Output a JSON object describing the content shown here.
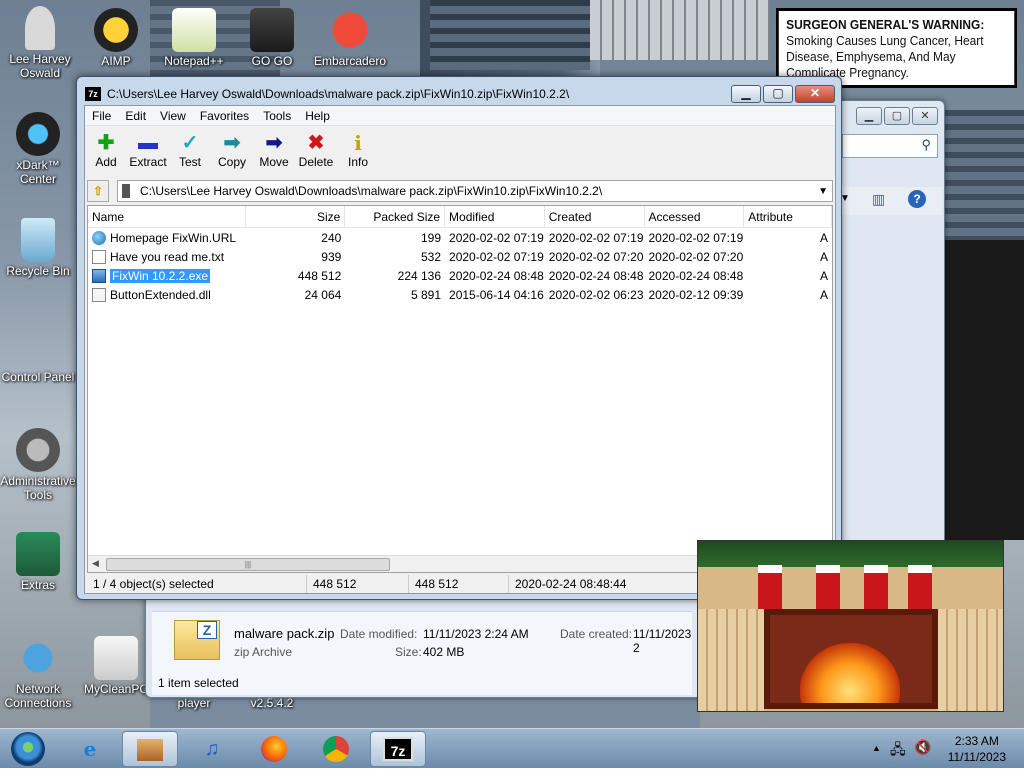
{
  "desktop": {
    "icons": [
      {
        "label": "Lee Harvey Oswald"
      },
      {
        "label": "AIMP"
      },
      {
        "label": "Notepad++"
      },
      {
        "label": "GO GO"
      },
      {
        "label": "Embarcadero"
      },
      {
        "label": "xDark™ Center"
      },
      {
        "label": "Recycle Bin"
      },
      {
        "label": "Control Panel"
      },
      {
        "label": "Administrative Tools"
      },
      {
        "label": "Extras"
      },
      {
        "label": "Network Connections"
      },
      {
        "label": "MyCleanPC"
      },
      {
        "label": "player"
      },
      {
        "label": "v2.5.4.2"
      }
    ],
    "warning": {
      "lead": "SURGEON GENERAL'S WARNING:",
      "text": "Smoking Causes Lung Cancer, Heart Disease, Emphysema, And May Complicate Pregnancy."
    }
  },
  "explorer": {
    "file_name": "malware pack.zip",
    "date_modified_label": "Date modified:",
    "date_modified": "11/11/2023 2:24 AM",
    "date_created_label": "Date created:",
    "date_created": "11/11/2023 2",
    "type": "zip Archive",
    "size_label": "Size:",
    "size": "402 MB",
    "status": "1 item selected"
  },
  "sevenzip": {
    "title": "C:\\Users\\Lee Harvey Oswald\\Downloads\\malware pack.zip\\FixWin10.zip\\FixWin10.2.2\\",
    "menu": [
      "File",
      "Edit",
      "View",
      "Favorites",
      "Tools",
      "Help"
    ],
    "toolbar": [
      {
        "label": "Add",
        "glyph": "✚",
        "color": "#19a019"
      },
      {
        "label": "Extract",
        "glyph": "▬",
        "color": "#2434c8"
      },
      {
        "label": "Test",
        "glyph": "✓",
        "color": "#20a8c8"
      },
      {
        "label": "Copy",
        "glyph": "➡",
        "color": "#1c8a9a"
      },
      {
        "label": "Move",
        "glyph": "➡",
        "color": "#101a90"
      },
      {
        "label": "Delete",
        "glyph": "✖",
        "color": "#d01818"
      },
      {
        "label": "Info",
        "glyph": "i",
        "color": "#c8a000"
      }
    ],
    "address": "C:\\Users\\Lee Harvey Oswald\\Downloads\\malware pack.zip\\FixWin10.zip\\FixWin10.2.2\\",
    "columns": [
      "Name",
      "Size",
      "Packed Size",
      "Modified",
      "Created",
      "Accessed",
      "Attribute"
    ],
    "files": [
      {
        "name": "Homepage FixWin.URL",
        "size": "240",
        "packed": "199",
        "modified": "2020-02-02 07:19",
        "created": "2020-02-02 07:19",
        "accessed": "2020-02-02 07:19",
        "attr": "A",
        "icon": "globe-icon"
      },
      {
        "name": "Have you read me.txt",
        "size": "939",
        "packed": "532",
        "modified": "2020-02-02 07:19",
        "created": "2020-02-02 07:20",
        "accessed": "2020-02-02 07:20",
        "attr": "A",
        "icon": "text-file-icon"
      },
      {
        "name": "FixWin 10.2.2.exe",
        "size": "448 512",
        "packed": "224 136",
        "modified": "2020-02-24 08:48",
        "created": "2020-02-24 08:48",
        "accessed": "2020-02-24 08:48",
        "attr": "A",
        "icon": "exe-icon"
      },
      {
        "name": "ButtonExtended.dll",
        "size": "24 064",
        "packed": "5 891",
        "modified": "2015-06-14 04:16",
        "created": "2020-02-02 06:23",
        "accessed": "2020-02-12 09:39",
        "attr": "A",
        "icon": "dll-icon"
      }
    ],
    "status": {
      "selected": "1 / 4 object(s) selected",
      "size": "448 512",
      "packed": "448 512",
      "date": "2020-02-24 08:48:44"
    }
  },
  "taskbar": {
    "time": "2:33 AM",
    "date": "11/11/2023"
  }
}
